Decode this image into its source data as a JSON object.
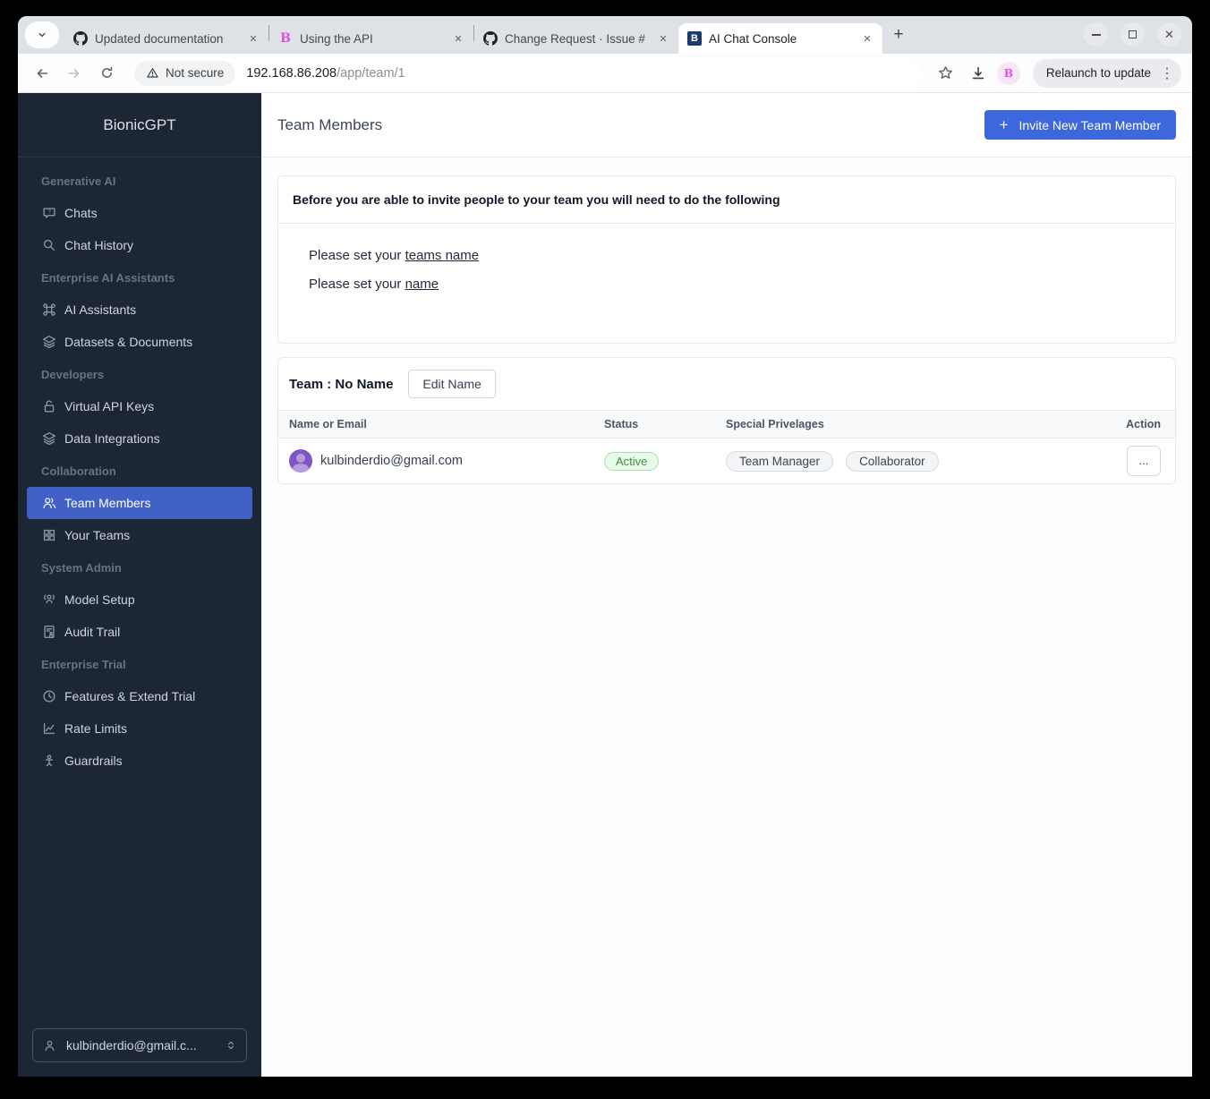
{
  "browser": {
    "tabs": [
      {
        "title": "Updated documentation",
        "icon": "github"
      },
      {
        "title": "Using the API",
        "icon": "bionic-pink"
      },
      {
        "title": "Change Request · Issue #",
        "icon": "github"
      },
      {
        "title": "AI Chat Console",
        "icon": "bionic-navy"
      }
    ],
    "favicon_letter": "B",
    "glyphs": {
      "close_tab": "✕",
      "new_tab": "+",
      "close_window": "✕",
      "kebab": "⋮",
      "ellipsis": "...",
      "plus": "+"
    },
    "toolbar": {
      "security_label": "Not secure",
      "url_host": "192.168.86.208",
      "url_path": "/app/team/1",
      "relaunch_label": "Relaunch to update"
    }
  },
  "sidebar": {
    "brand": "BionicGPT",
    "sections": [
      {
        "label": "Generative AI",
        "items": [
          {
            "label": "Chats"
          },
          {
            "label": "Chat History"
          }
        ]
      },
      {
        "label": "Enterprise AI Assistants",
        "items": [
          {
            "label": "AI Assistants"
          },
          {
            "label": "Datasets & Documents"
          }
        ]
      },
      {
        "label": "Developers",
        "items": [
          {
            "label": "Virtual API Keys"
          },
          {
            "label": "Data Integrations"
          }
        ]
      },
      {
        "label": "Collaboration",
        "items": [
          {
            "label": "Team Members"
          },
          {
            "label": "Your Teams"
          }
        ]
      },
      {
        "label": "System Admin",
        "items": [
          {
            "label": "Model Setup"
          },
          {
            "label": "Audit Trail"
          }
        ]
      },
      {
        "label": "Enterprise Trial",
        "items": [
          {
            "label": "Features & Extend Trial"
          },
          {
            "label": "Rate Limits"
          },
          {
            "label": "Guardrails"
          }
        ]
      }
    ],
    "user_select": "kulbinderdio@gmail.c..."
  },
  "main": {
    "page_title": "Team Members",
    "invite_button_label": "Invite New Team Member",
    "notice": {
      "header": "Before you are able to invite people to your team you will need to do the following",
      "line1_prefix": "Please set your ",
      "line1_link": "teams name",
      "line2_prefix": "Please set your ",
      "line2_link": "name"
    },
    "team_card": {
      "title": "Team : No Name",
      "edit_button_label": "Edit Name",
      "columns": [
        "Name or Email",
        "Status",
        "Special Privelages",
        "Action"
      ],
      "member": {
        "email": "kulbinderdio@gmail.com",
        "status": "Active",
        "privileges": [
          "Team Manager",
          "Collaborator"
        ]
      }
    }
  },
  "colors": {
    "accent_blue": "#3d68dd",
    "sidebar_selected_blue": "#4261c6",
    "sidebar_bg": "#1d2634",
    "status_green": "#3f9142",
    "avatar_purple": "#7e57c2"
  }
}
